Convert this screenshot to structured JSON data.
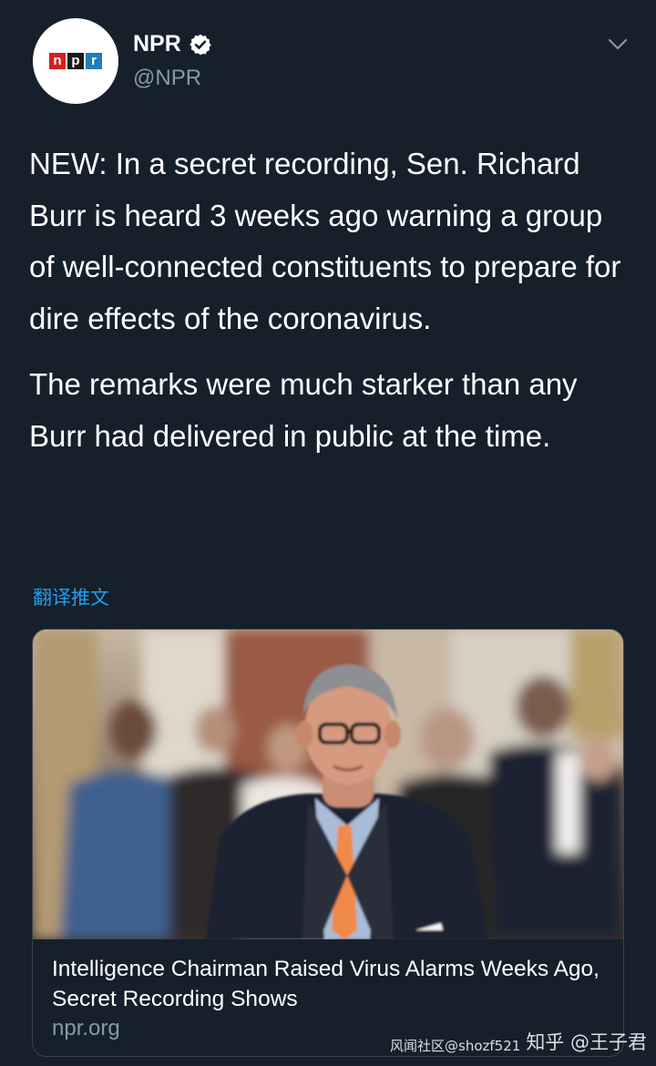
{
  "author": {
    "name": "NPR",
    "handle": "@NPR",
    "avatar_logo": [
      "n",
      "p",
      "r"
    ],
    "verified_icon": "verified-badge-icon"
  },
  "menu_icon": "chevron-down-icon",
  "tweet": {
    "paragraphs": [
      "NEW: In a secret recording, Sen. Richard Burr is heard 3 weeks ago warning a group of well-connected constituents to prepare for dire effects of the coronavirus.",
      "The remarks were much starker than any Burr had delivered in public at the time."
    ],
    "translate_label": "翻译推文"
  },
  "card": {
    "title": "Intelligence Chairman Raised Virus Alarms Weeks Ago, Secret Recording Shows",
    "domain": "npr.org"
  },
  "watermark": {
    "main": "知乎 @王子君",
    "sub": "风闻社区@shozf521"
  },
  "colors": {
    "background": "#15202b",
    "link": "#1da1f2",
    "secondary_text": "#8899a6",
    "border": "#38444d"
  }
}
